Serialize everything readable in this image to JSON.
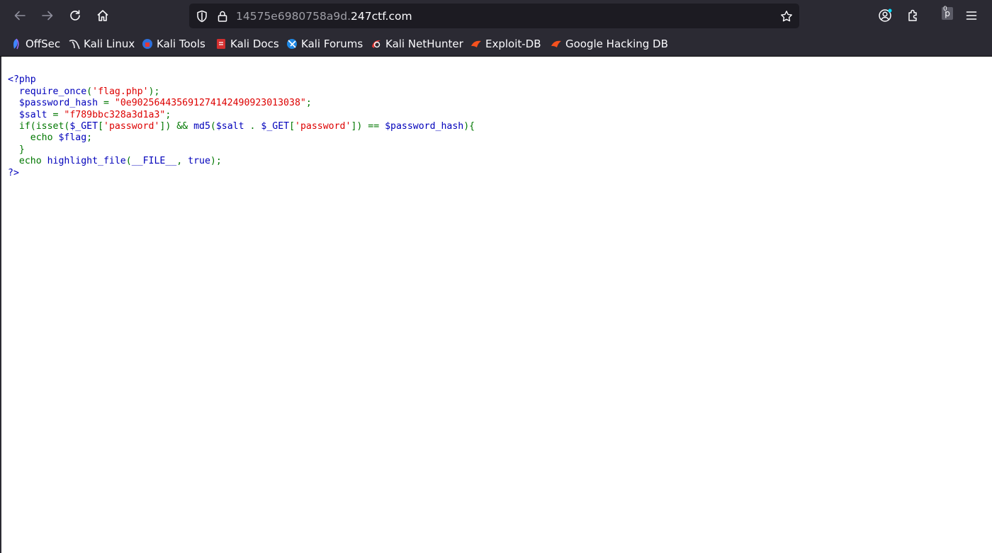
{
  "url": {
    "subdomain": "14575e6980758a9d.",
    "domain": "247ctf.com"
  },
  "extension_badge": {
    "letter": "p",
    "count": "0"
  },
  "bookmarks": [
    {
      "label": "OffSec",
      "icon": "offsec-icon"
    },
    {
      "label": "Kali Linux",
      "icon": "kali-dragon-icon"
    },
    {
      "label": "Kali Tools",
      "icon": "kali-tools-icon"
    },
    {
      "label": "Kali Docs",
      "icon": "kali-docs-icon"
    },
    {
      "label": "Kali Forums",
      "icon": "kali-forums-icon"
    },
    {
      "label": "Kali NetHunter",
      "icon": "kali-nethunter-icon"
    },
    {
      "label": "Exploit-DB",
      "icon": "exploit-db-icon"
    },
    {
      "label": "Google Hacking DB",
      "icon": "ghdb-icon"
    }
  ],
  "code": {
    "l1": "<?php",
    "l2_indent": "  ",
    "l2_fn": "require_once",
    "l2_open": "(",
    "l2_str": "'flag.php'",
    "l2_close": ");",
    "l3_indent": "  ",
    "l3_var": "$password_hash",
    "l3_eq": " = ",
    "l3_str": "\"0e902564435691274142490923013038\"",
    "l3_end": ";",
    "l4_indent": "  ",
    "l4_var": "$salt",
    "l4_eq": " = ",
    "l4_str": "\"f789bbc328a3d1a3\"",
    "l4_end": ";",
    "l5_indent": "  ",
    "l5_a": "if(isset(",
    "l5_b": "$_GET",
    "l5_c": "[",
    "l5_d": "'password'",
    "l5_e": "]) && ",
    "l5_f": "md5",
    "l5_g": "(",
    "l5_h": "$salt ",
    "l5_i": ". ",
    "l5_j": "$_GET",
    "l5_k": "[",
    "l5_l": "'password'",
    "l5_m": "]) == ",
    "l5_n": "$password_hash",
    "l5_o": "){",
    "l6_indent": "    ",
    "l6_kw": "echo ",
    "l6_var": "$flag",
    "l6_end": ";",
    "l7": "  }",
    "l8_indent": "  ",
    "l8_kw": "echo ",
    "l8_fn": "highlight_file",
    "l8_open": "(",
    "l8_const": "__FILE__",
    "l8_comma": ", ",
    "l8_true": "true",
    "l8_close": ");",
    "l9": "?>"
  },
  "colors": {
    "php_default": "#0000bb",
    "php_string": "#dd0000",
    "php_keyword": "#007700",
    "toolbar_bg": "#2b2a33",
    "urlbar_bg": "#1c1b22"
  }
}
